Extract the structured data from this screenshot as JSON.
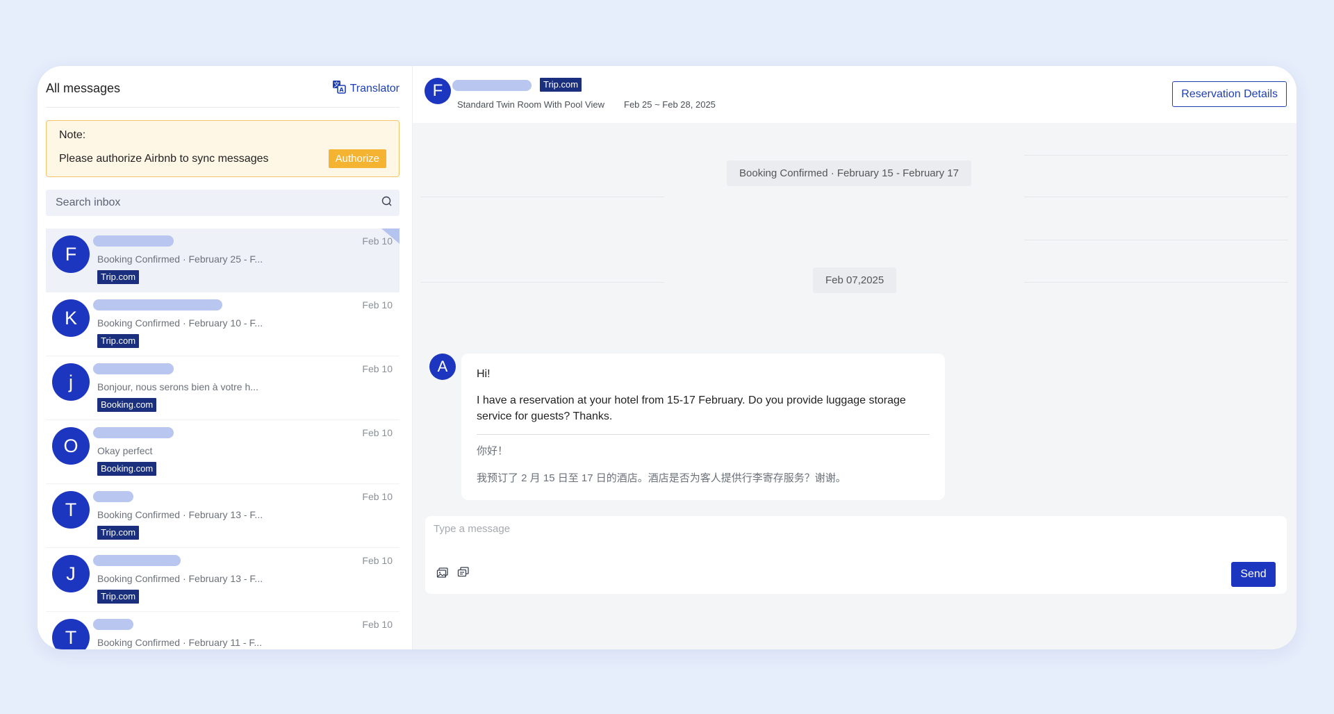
{
  "inbox": {
    "title": "All messages",
    "translator_label": "Translator",
    "note": {
      "label": "Note:",
      "text": "Please authorize Airbnb to sync messages",
      "button": "Authorize"
    },
    "search_placeholder": "Search inbox",
    "conversations": [
      {
        "initial": "F",
        "date": "Feb 10",
        "preview": "Booking Confirmed · February 25 - F...",
        "channel": "Trip.com",
        "active": true
      },
      {
        "initial": "K",
        "date": "Feb 10",
        "preview": "Booking Confirmed · February 10 - F...",
        "channel": "Trip.com"
      },
      {
        "initial": "j",
        "date": "Feb 10",
        "preview": "Bonjour, nous serons bien à votre h...",
        "channel": "Booking.com"
      },
      {
        "initial": "O",
        "date": "Feb 10",
        "preview": "Okay perfect",
        "channel": "Booking.com"
      },
      {
        "initial": "T",
        "date": "Feb 10",
        "preview": "Booking Confirmed · February 13 - F...",
        "channel": "Trip.com"
      },
      {
        "initial": "J",
        "date": "Feb 10",
        "preview": "Booking Confirmed · February 13 - F...",
        "channel": "Trip.com"
      },
      {
        "initial": "T",
        "date": "Feb 10",
        "preview": "Booking Confirmed · February 11 - F...",
        "channel": ""
      }
    ]
  },
  "chat": {
    "guest_initial": "F",
    "channel": "Trip.com",
    "room": "Standard Twin Room With Pool View",
    "dates": "Feb 25 ~ Feb 28, 2025",
    "reservation_button": "Reservation Details",
    "system_pill": "Booking Confirmed · February 15 - February 17",
    "date_pill": "Feb 07,2025",
    "message": {
      "sender_initial": "A",
      "greeting": "Hi!",
      "body": "I have a reservation at your hotel from 15-17 February. Do you provide luggage storage service for guests? Thanks.",
      "translated_greeting": "你好！",
      "translated_body": "我预订了 2 月 15 日至 17 日的酒店。酒店是否为客人提供行李寄存服务？谢谢。"
    },
    "composer_placeholder": "Type a message",
    "send_label": "Send"
  },
  "colors": {
    "background": "#e6edfb",
    "brand_blue": "#1d36c0",
    "tag_navy": "#1a2f7d",
    "authorize_orange": "#f5b332",
    "note_bg": "#fff7e6"
  },
  "icons": [
    "translator-icon",
    "search-icon",
    "image-upload-icon",
    "template-icon"
  ]
}
